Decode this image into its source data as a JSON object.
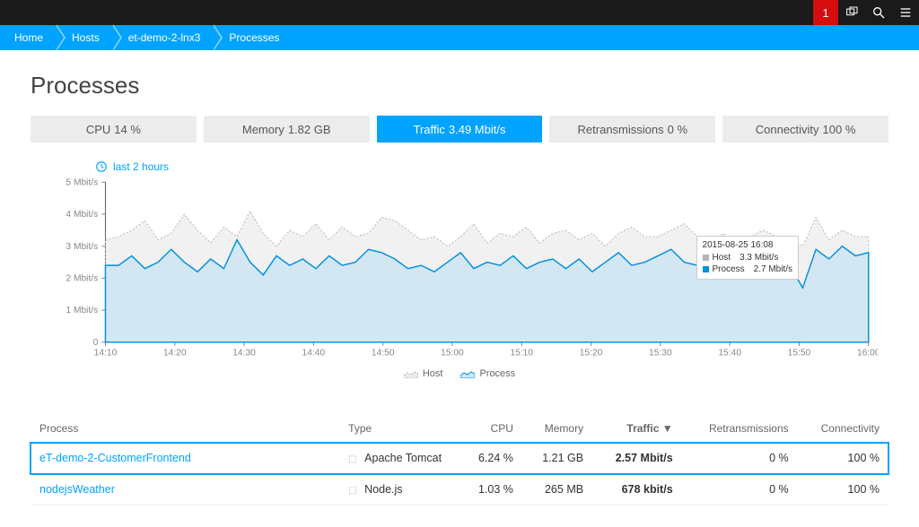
{
  "topbar": {
    "alert_count": "1"
  },
  "breadcrumbs": [
    "Home",
    "Hosts",
    "et-demo-2-lnx3",
    "Processes"
  ],
  "page": {
    "title": "Processes",
    "timeframe_label": "last 2 hours"
  },
  "tabs": [
    {
      "label": "CPU",
      "value": "14 %",
      "active": false
    },
    {
      "label": "Memory",
      "value": "1.82 GB",
      "active": false
    },
    {
      "label": "Traffic",
      "value": "3.49 Mbit/s",
      "active": true
    },
    {
      "label": "Retransmissions",
      "value": "0 %",
      "active": false
    },
    {
      "label": "Connectivity",
      "value": "100 %",
      "active": false
    }
  ],
  "chart_data": {
    "type": "area",
    "title": "",
    "xlabel": "",
    "ylabel": "Mbit/s",
    "ylim": [
      0,
      5
    ],
    "y_ticks": [
      0,
      1,
      2,
      3,
      4,
      5
    ],
    "y_tick_labels": [
      "0",
      "1 Mbit/s",
      "2 Mbit/s",
      "3 Mbit/s",
      "4 Mbit/s",
      "5 Mbit/s"
    ],
    "categories": [
      "14:10",
      "14:20",
      "14:30",
      "14:40",
      "14:50",
      "15:00",
      "15:10",
      "15:20",
      "15:30",
      "15:40",
      "15:50",
      "16:00"
    ],
    "series": [
      {
        "name": "Host",
        "values": [
          3.2,
          3.3,
          3.5,
          3.8,
          3.2,
          3.4,
          4.0,
          3.5,
          3.1,
          3.6,
          3.3,
          4.1,
          3.4,
          3.0,
          3.5,
          3.3,
          3.7,
          3.2,
          3.6,
          3.3,
          3.4,
          3.9,
          3.8,
          3.5,
          3.2,
          3.3,
          3.0,
          3.3,
          3.7,
          3.1,
          3.4,
          3.3,
          3.6,
          3.1,
          3.4,
          3.5,
          3.2,
          3.4,
          3.0,
          3.4,
          3.6,
          3.3,
          3.3,
          3.5,
          3.7,
          3.3,
          3.2,
          3.4,
          3.1,
          3.3,
          3.5,
          3.3,
          3.2,
          3.0,
          3.9,
          3.2,
          3.5,
          3.3,
          3.3
        ]
      },
      {
        "name": "Process",
        "values": [
          2.4,
          2.4,
          2.7,
          2.3,
          2.5,
          2.9,
          2.5,
          2.2,
          2.6,
          2.3,
          3.2,
          2.5,
          2.1,
          2.7,
          2.4,
          2.6,
          2.3,
          2.7,
          2.4,
          2.5,
          2.9,
          2.8,
          2.6,
          2.3,
          2.4,
          2.2,
          2.5,
          2.8,
          2.3,
          2.5,
          2.4,
          2.7,
          2.3,
          2.5,
          2.6,
          2.3,
          2.6,
          2.2,
          2.5,
          2.8,
          2.4,
          2.5,
          2.7,
          2.9,
          2.5,
          2.4,
          2.5,
          2.3,
          2.5,
          2.7,
          2.4,
          2.7,
          2.4,
          1.7,
          2.9,
          2.6,
          3.0,
          2.7,
          2.8
        ]
      }
    ],
    "legend": [
      "Host",
      "Process"
    ],
    "tooltip": {
      "timestamp": "2015-08-25 16:08",
      "rows": [
        {
          "series": "Host",
          "value": "3.3 Mbit/s"
        },
        {
          "series": "Process",
          "value": "2.7 Mbit/s"
        }
      ]
    }
  },
  "table": {
    "columns": [
      "Process",
      "Type",
      "CPU",
      "Memory",
      "Traffic",
      "Retransmissions",
      "Connectivity"
    ],
    "sort_column": "Traffic",
    "sort_indicator": "▼",
    "rows": [
      {
        "process": "eT-demo-2-CustomerFrontend",
        "type": "Apache Tomcat",
        "cpu": "6.24 %",
        "memory": "1.21 GB",
        "traffic": "2.57 Mbit/s",
        "retransmissions": "0 %",
        "connectivity": "100 %",
        "selected": true
      },
      {
        "process": "nodejsWeather",
        "type": "Node.js",
        "cpu": "1.03 %",
        "memory": "265 MB",
        "traffic": "678 kbit/s",
        "retransmissions": "0 %",
        "connectivity": "100 %",
        "selected": false
      }
    ]
  }
}
